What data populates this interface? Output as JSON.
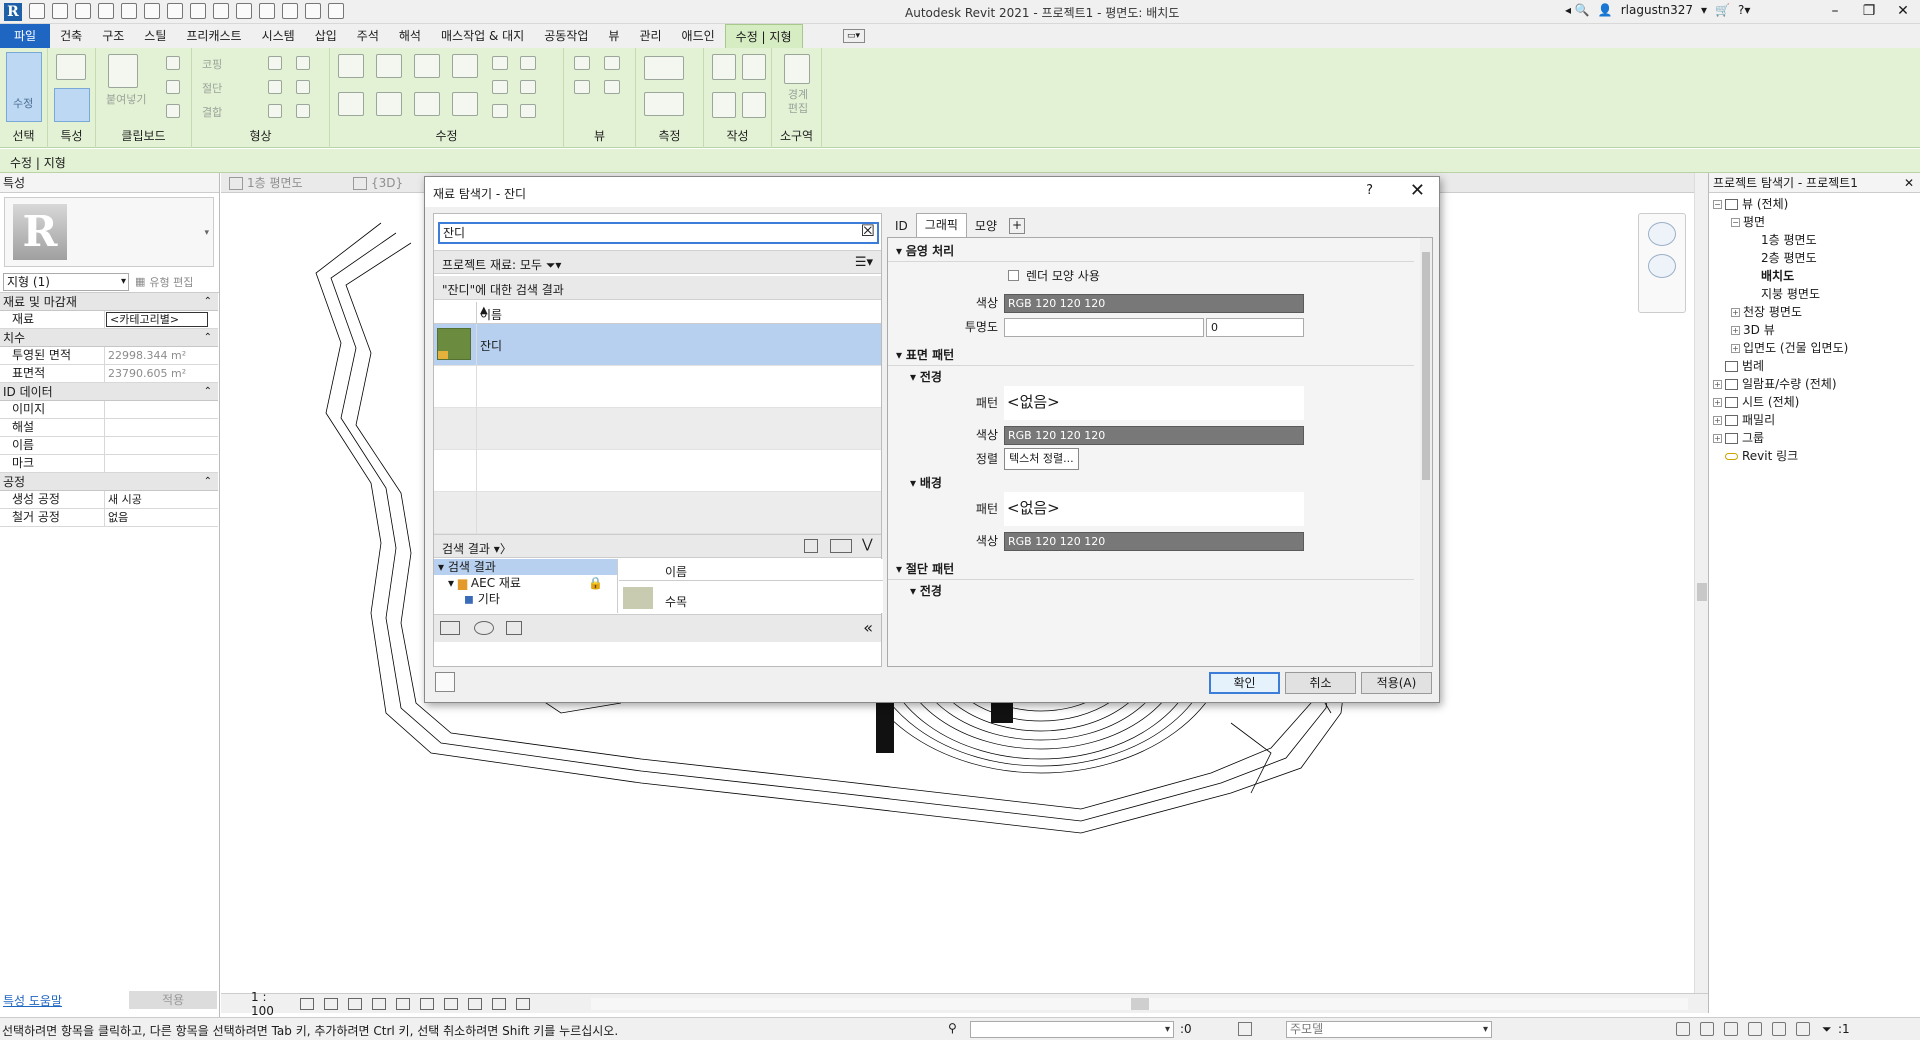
{
  "window": {
    "title": "Autodesk Revit 2021 - 프로젝트1 - 평면도: 배치도",
    "username": "rlagustn327"
  },
  "ribbon": {
    "tabs": [
      "파일",
      "건축",
      "구조",
      "스틸",
      "프리캐스트",
      "시스템",
      "삽입",
      "주석",
      "해석",
      "매스작업 & 대지",
      "공동작업",
      "뷰",
      "관리",
      "애드인",
      "수정 | 지형"
    ],
    "active_tab": "수정 | 지형",
    "modify_label": "수정",
    "paste_label": "붙여넣기",
    "copy_label": "코핑",
    "cut_label": "절단",
    "join_label": "결합",
    "boundary_edit_label": "경계 편집",
    "panels": {
      "select": "선택",
      "properties": "특성",
      "clipboard": "클립보드",
      "geometry": "형상",
      "modify": "수정",
      "view": "뷰",
      "measure": "측정",
      "create": "작성",
      "subregion": "소구역"
    }
  },
  "context_bar": {
    "label": "수정 | 지형"
  },
  "properties": {
    "header": "특성",
    "type_selector": "지형 (1)",
    "edit_type": "유형 편집",
    "groups": [
      {
        "name": "재료 및 마감재",
        "rows": [
          {
            "k": "재료",
            "v": "<카테고리별>"
          }
        ]
      },
      {
        "name": "치수",
        "rows": [
          {
            "k": "투영된 면적",
            "v": "22998.344 m²"
          },
          {
            "k": "표면적",
            "v": "23790.605 m²"
          }
        ]
      },
      {
        "name": "ID 데이터",
        "rows": [
          {
            "k": "이미지",
            "v": ""
          },
          {
            "k": "해설",
            "v": ""
          },
          {
            "k": "이름",
            "v": ""
          },
          {
            "k": "마크",
            "v": ""
          }
        ]
      },
      {
        "name": "공정",
        "rows": [
          {
            "k": "생성 공정",
            "v": "새 시공"
          },
          {
            "k": "철거 공정",
            "v": "없음"
          }
        ]
      }
    ],
    "help_link": "특성 도움말",
    "apply": "적용"
  },
  "view_tabs": [
    "1층 평면도",
    "{3D}"
  ],
  "view_control": {
    "scale": "1 : 100"
  },
  "project_browser": {
    "header": "프로젝트 탐색기 - 프로젝트1",
    "tree": [
      {
        "label": "뷰 (전체)",
        "level": 0,
        "exp": "-",
        "icon": true
      },
      {
        "label": "평면",
        "level": 1,
        "exp": "-"
      },
      {
        "label": "1층 평면도",
        "level": 2
      },
      {
        "label": "2층 평면도",
        "level": 2
      },
      {
        "label": "배치도",
        "level": 2,
        "bold": true
      },
      {
        "label": "지붕 평면도",
        "level": 2
      },
      {
        "label": "천장 평면도",
        "level": 1,
        "exp": "+"
      },
      {
        "label": "3D 뷰",
        "level": 1,
        "exp": "+"
      },
      {
        "label": "입면도 (건물 입면도)",
        "level": 1,
        "exp": "+"
      },
      {
        "label": "범례",
        "level": 0,
        "icon": true
      },
      {
        "label": "일람표/수량 (전체)",
        "level": 0,
        "exp": "+",
        "icon": true
      },
      {
        "label": "시트 (전체)",
        "level": 0,
        "exp": "+",
        "icon": true
      },
      {
        "label": "패밀리",
        "level": 0,
        "exp": "+",
        "icon": true
      },
      {
        "label": "그룹",
        "level": 0,
        "exp": "+",
        "icon": true
      },
      {
        "label": "Revit 링크",
        "level": 0,
        "link": true
      }
    ]
  },
  "status_bar": {
    "message": "선택하려면 항목을 클릭하고, 다른 항목을 선택하려면 Tab 키, 추가하려면 Ctrl 키, 선택 취소하려면 Shift 키를 누르십시오.",
    "selection_count": ":0",
    "workset": "주모델",
    "filter_count": ":1"
  },
  "dialog": {
    "title": "재료 탐색기 - 잔디",
    "help": "?",
    "search_value": "잔디",
    "filter_label": "프로젝트 재료: 모두",
    "results_header": "\"잔디\"에 대한 검색 결과",
    "col_name": "이름",
    "results": [
      "잔디"
    ],
    "library_label": "검색 결과",
    "library_tree": [
      "검색 결과",
      "AEC 재료",
      "기타"
    ],
    "library_item": "수목",
    "tabs": [
      "ID",
      "그래픽",
      "모양"
    ],
    "active_tab": "그래픽",
    "graphics": {
      "shading": "음영 처리",
      "render_appearance": "렌더 모양 사용",
      "color_label": "색상",
      "color_value": "RGB 120 120 120",
      "transparency_label": "투명도",
      "transparency_value": "0",
      "surface_pattern": "표면 패턴",
      "foreground": "전경",
      "pattern_label": "패턴",
      "pattern_value": "<없음>",
      "align_label": "정렬",
      "align_button": "텍스처 정렬...",
      "background": "배경",
      "cut_pattern": "절단 패턴",
      "cut_foreground": "전경"
    },
    "buttons": {
      "ok": "확인",
      "cancel": "취소",
      "apply": "적용(A)"
    }
  }
}
